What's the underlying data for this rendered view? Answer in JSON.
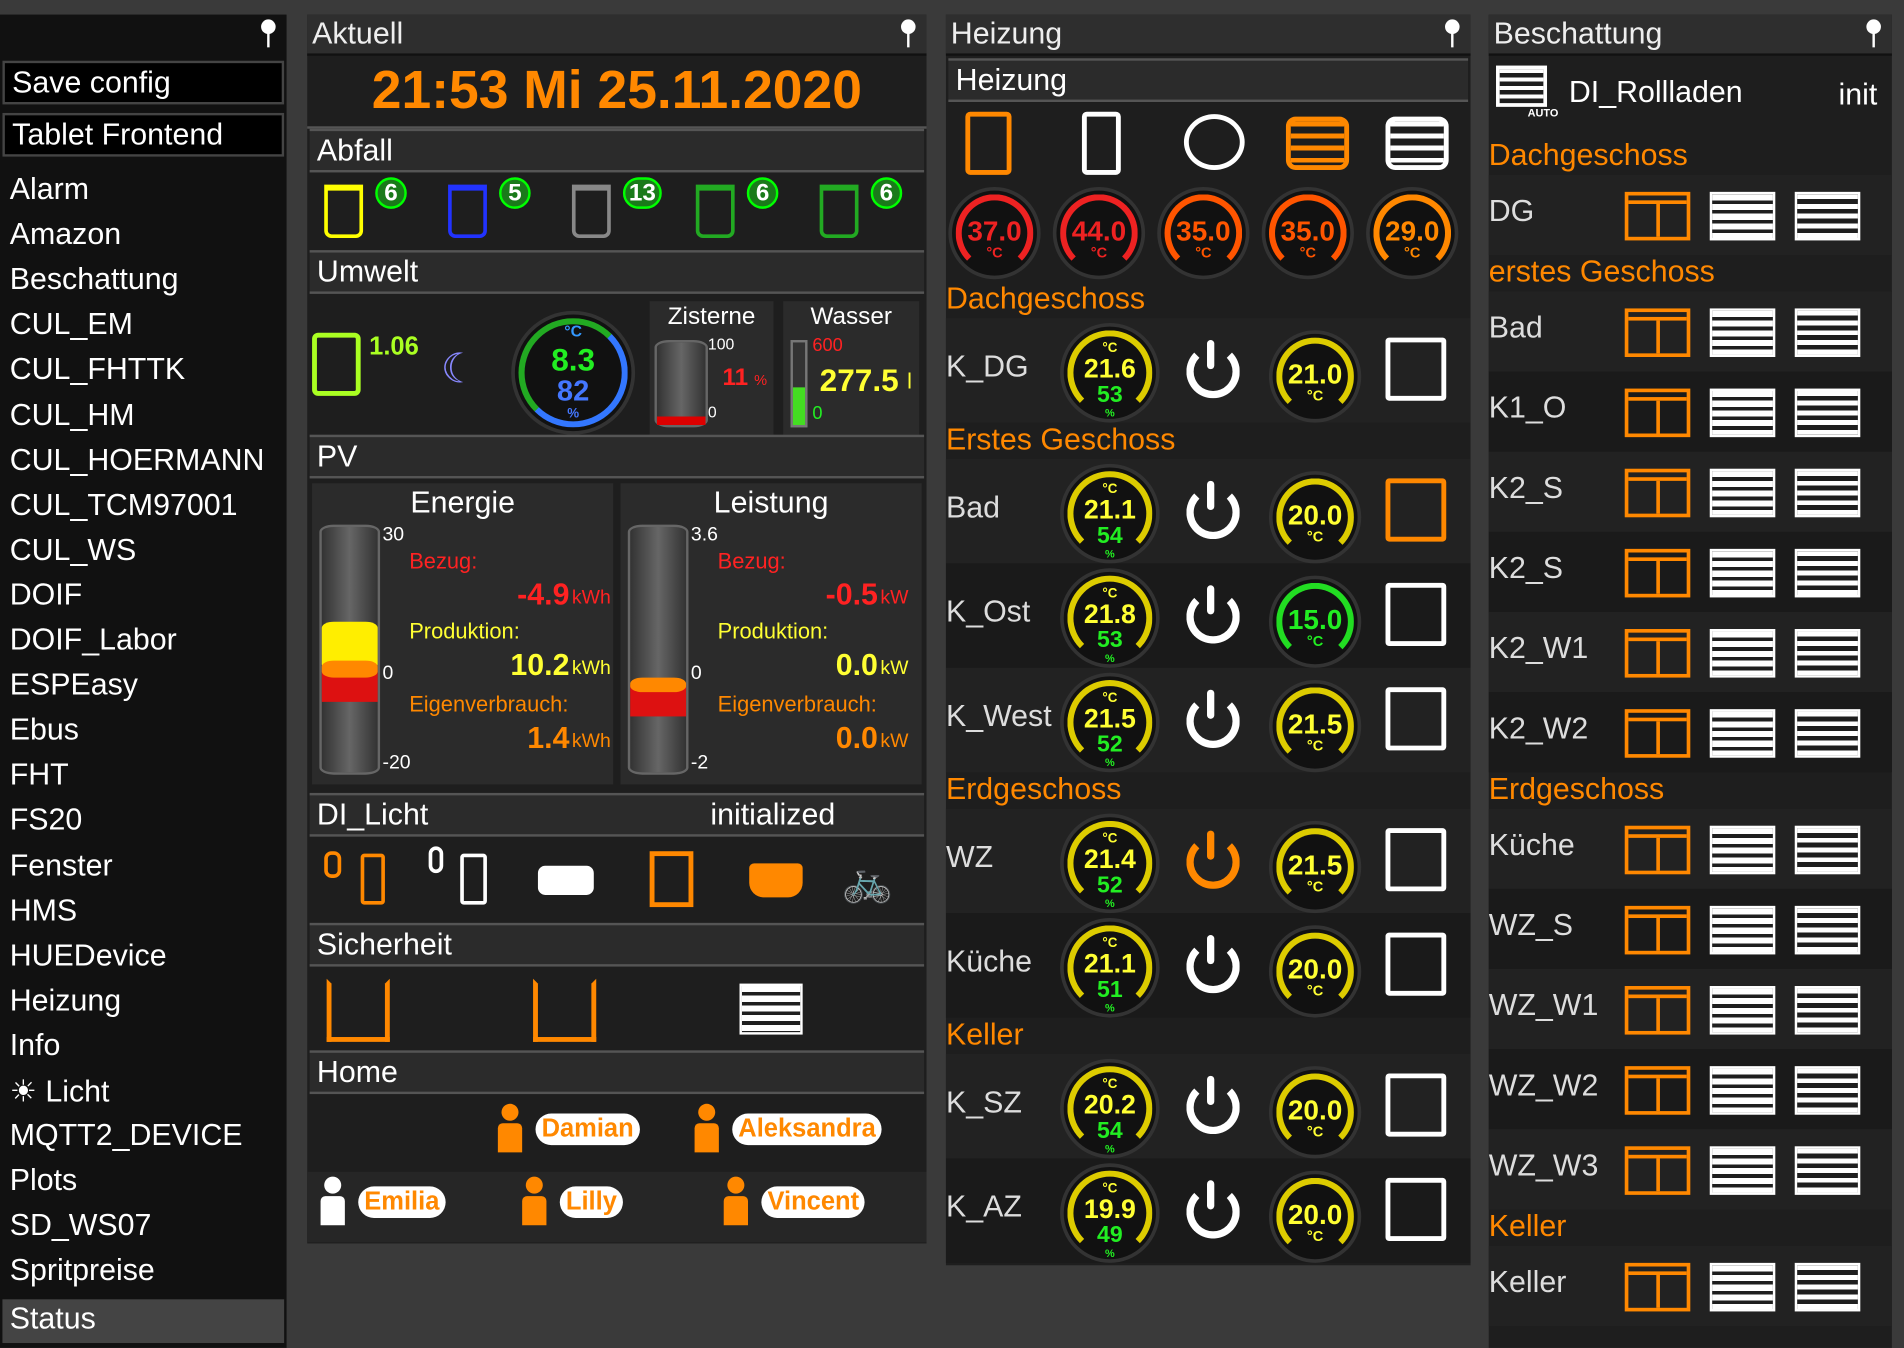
{
  "sidebar": {
    "buttons": [
      "Save config",
      "Tablet Frontend"
    ],
    "items": [
      "Alarm",
      "Amazon",
      "Beschattung",
      "CUL_EM",
      "CUL_FHTTK",
      "CUL_HM",
      "CUL_HOERMANN",
      "CUL_TCM97001",
      "CUL_WS",
      "DOIF",
      "DOIF_Labor",
      "ESPEasy",
      "Ebus",
      "FHT",
      "FS20",
      "Fenster",
      "HMS",
      "HUEDevice",
      "Heizung",
      "Info",
      "Licht",
      "MQTT2_DEVICE",
      "Plots",
      "SD_WS07",
      "Spritpreise",
      "Status"
    ],
    "selected": "Status"
  },
  "aktuell": {
    "title": "Aktuell",
    "clock": "21:53  Mi 25.11.2020",
    "abfall": {
      "label": "Abfall",
      "bins": [
        {
          "count": "6",
          "color": "#ffff00"
        },
        {
          "count": "5",
          "color": "#2233ff"
        },
        {
          "count": "13",
          "color": "#888888"
        },
        {
          "count": "6",
          "color": "#22aa22"
        },
        {
          "count": "6",
          "color": "#22aa22"
        }
      ]
    },
    "umwelt": {
      "label": "Umwelt",
      "fuel": "1.06",
      "temp": "8.3",
      "temp_unit": "°C",
      "humidity": "82",
      "humidity_unit": "%",
      "zisterne": {
        "label": "Zisterne",
        "max": "100",
        "min": "0",
        "value": "11",
        "unit": "%",
        "level": 0.11
      },
      "wasser": {
        "label": "Wasser",
        "max": "600",
        "min": "0",
        "value": "277.5",
        "unit": "l",
        "level": 0.46
      }
    },
    "pv": {
      "label": "PV",
      "energie": {
        "title": "Energie",
        "max": "30",
        "zero": "0",
        "min": "-20",
        "bezug_label": "Bezug:",
        "bezug": "-4.9",
        "bezug_unit": "kWh",
        "prod_label": "Produktion:",
        "prod": "10.2",
        "prod_unit": "kWh",
        "eigen_label": "Eigenverbrauch:",
        "eigen": "1.4",
        "eigen_unit": "kWh"
      },
      "leistung": {
        "title": "Leistung",
        "max": "3.6",
        "zero": "0",
        "min": "-2",
        "bezug_label": "Bezug:",
        "bezug": "-0.5",
        "bezug_unit": "kW",
        "prod_label": "Produktion:",
        "prod": "0.0",
        "prod_unit": "kW",
        "eigen_label": "Eigenverbrauch:",
        "eigen": "0.0",
        "eigen_unit": "kW"
      }
    },
    "licht": {
      "label": "DI_Licht",
      "status": "initialized"
    },
    "sicherheit": {
      "label": "Sicherheit"
    },
    "home": {
      "label": "Home",
      "persons": [
        "Damian",
        "Aleksandra",
        "Emilia",
        "Lilly",
        "Vincent"
      ]
    }
  },
  "heizung": {
    "title": "Heizung",
    "subtitle": "Heizung",
    "top_gauges": [
      {
        "v": "37.0",
        "u": "°C"
      },
      {
        "v": "44.0",
        "u": "°C"
      },
      {
        "v": "35.0",
        "u": "°C"
      },
      {
        "v": "35.0",
        "u": "°C"
      },
      {
        "v": "29.0",
        "u": "°C"
      }
    ],
    "sections": [
      {
        "label": "Dachgeschoss",
        "rooms": [
          {
            "name": "K_DG",
            "t": "21.6",
            "h": "53",
            "set": "21.0"
          }
        ]
      },
      {
        "label": "Erstes Geschoss",
        "rooms": [
          {
            "name": "Bad",
            "t": "21.1",
            "h": "54",
            "set": "20.0"
          },
          {
            "name": "K_Ost",
            "t": "21.8",
            "h": "53",
            "set": "15.0"
          },
          {
            "name": "K_West",
            "t": "21.5",
            "h": "52",
            "set": "21.5"
          }
        ]
      },
      {
        "label": "Erdgeschoss",
        "rooms": [
          {
            "name": "WZ",
            "t": "21.4",
            "h": "52",
            "set": "21.5"
          },
          {
            "name": "Küche",
            "t": "21.1",
            "h": "51",
            "set": "20.0"
          }
        ]
      },
      {
        "label": "Keller",
        "rooms": [
          {
            "name": "K_SZ",
            "t": "20.2",
            "h": "54",
            "set": "20.0"
          },
          {
            "name": "K_AZ",
            "t": "19.9",
            "h": "49",
            "set": "20.0"
          }
        ]
      }
    ],
    "unit_c": "°C",
    "unit_h": "%"
  },
  "beschattung": {
    "title": "Beschattung",
    "device": "DI_Rollladen",
    "state": "init",
    "auto": "AUTO",
    "sections": [
      {
        "label": "Dachgeschoss",
        "rooms": [
          "DG"
        ]
      },
      {
        "label": "erstes Geschoss",
        "rooms": [
          "Bad",
          "K1_O",
          "K2_S",
          "K2_S",
          "K2_W1",
          "K2_W2"
        ]
      },
      {
        "label": "Erdgeschoss",
        "rooms": [
          "Küche",
          "WZ_S",
          "WZ_W1",
          "WZ_W2",
          "WZ_W3"
        ]
      },
      {
        "label": "Keller",
        "rooms": [
          "Keller"
        ]
      }
    ]
  }
}
